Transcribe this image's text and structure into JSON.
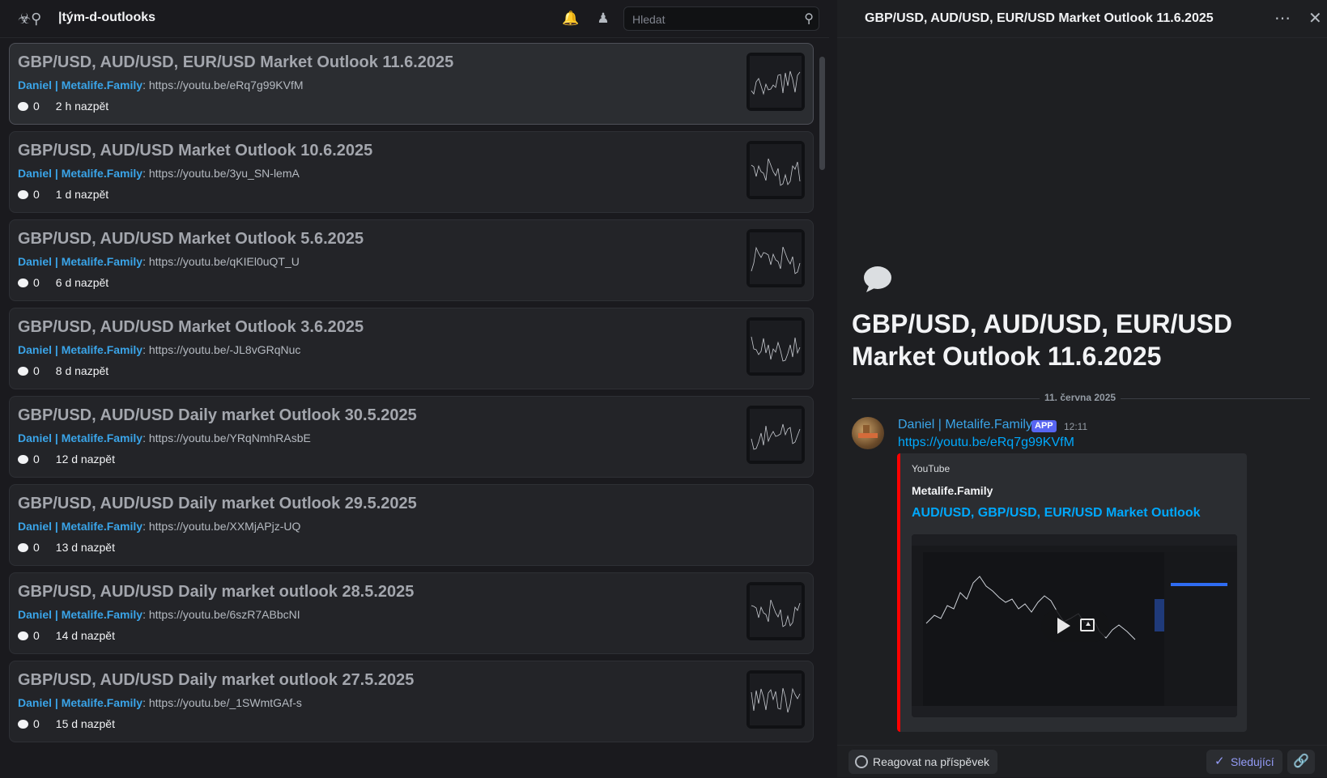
{
  "header": {
    "channel_name": "|tým-d-outlooks",
    "search_placeholder": "Hledat"
  },
  "posts": [
    {
      "title": "GBP/USD, AUD/USD, EUR/USD Market Outlook 11.6.2025",
      "author": "Daniel | Metalife.Family",
      "link": "https://youtu.be/eRq7g99KVfM",
      "comments": "0",
      "time": "2 h nazpět",
      "active": true,
      "has_thumb": true
    },
    {
      "title": "GBP/USD, AUD/USD Market Outlook 10.6.2025",
      "author": "Daniel | Metalife.Family",
      "link": "https://youtu.be/3yu_SN-lemA",
      "comments": "0",
      "time": "1 d nazpět",
      "has_thumb": true
    },
    {
      "title": "GBP/USD, AUD/USD Market Outlook 5.6.2025",
      "author": "Daniel | Metalife.Family",
      "link": "https://youtu.be/qKIEl0uQT_U",
      "comments": "0",
      "time": "6 d nazpět",
      "has_thumb": true
    },
    {
      "title": "GBP/USD, AUD/USD Market Outlook 3.6.2025",
      "author": "Daniel | Metalife.Family",
      "link": "https://youtu.be/-JL8vGRqNuc",
      "comments": "0",
      "time": "8 d nazpět",
      "has_thumb": true
    },
    {
      "title": "GBP/USD, AUD/USD Daily market Outlook 30.5.2025",
      "author": "Daniel | Metalife.Family",
      "link": "https://youtu.be/YRqNmhRAsbE",
      "comments": "0",
      "time": "12 d nazpět",
      "has_thumb": true
    },
    {
      "title": "GBP/USD, AUD/USD Daily market Outlook 29.5.2025",
      "author": "Daniel | Metalife.Family",
      "link": "https://youtu.be/XXMjAPjz-UQ",
      "comments": "0",
      "time": "13 d nazpět",
      "has_thumb": false
    },
    {
      "title": "GBP/USD, AUD/USD Daily market outlook 28.5.2025",
      "author": "Daniel | Metalife.Family",
      "link": "https://youtu.be/6szR7ABbcNI",
      "comments": "0",
      "time": "14 d nazpět",
      "has_thumb": true
    },
    {
      "title": "GBP/USD, AUD/USD Daily market outlook 27.5.2025",
      "author": "Daniel | Metalife.Family",
      "link": "https://youtu.be/_1SWmtGAf-s",
      "comments": "0",
      "time": "15 d nazpět",
      "has_thumb": true
    }
  ],
  "thread": {
    "header_title": "GBP/USD, AUD/USD, EUR/USD Market Outlook 11.6.2025",
    "big_title": "GBP/USD, AUD/USD, EUR/USD Market Outlook 11.6.2025",
    "date": "11. června 2025",
    "message": {
      "author": "Daniel | Metalife.Family",
      "badge": "APP",
      "time": "12:11",
      "link": "https://youtu.be/eRq7g99KVfM"
    },
    "embed": {
      "provider": "YouTube",
      "channel": "Metalife.Family",
      "title": "AUD/USD, GBP/USD, EUR/USD Market Outlook",
      "accent_color": "#ff0000"
    }
  },
  "footer": {
    "react_label": "Reagovat na příspěvek",
    "follow_label": "Sledující"
  },
  "icons": {
    "channel": "forum-icon",
    "bell": "bell-icon",
    "members": "members-icon",
    "search": "search-icon",
    "more": "more-icon",
    "close": "close-icon",
    "link": "link-icon"
  }
}
